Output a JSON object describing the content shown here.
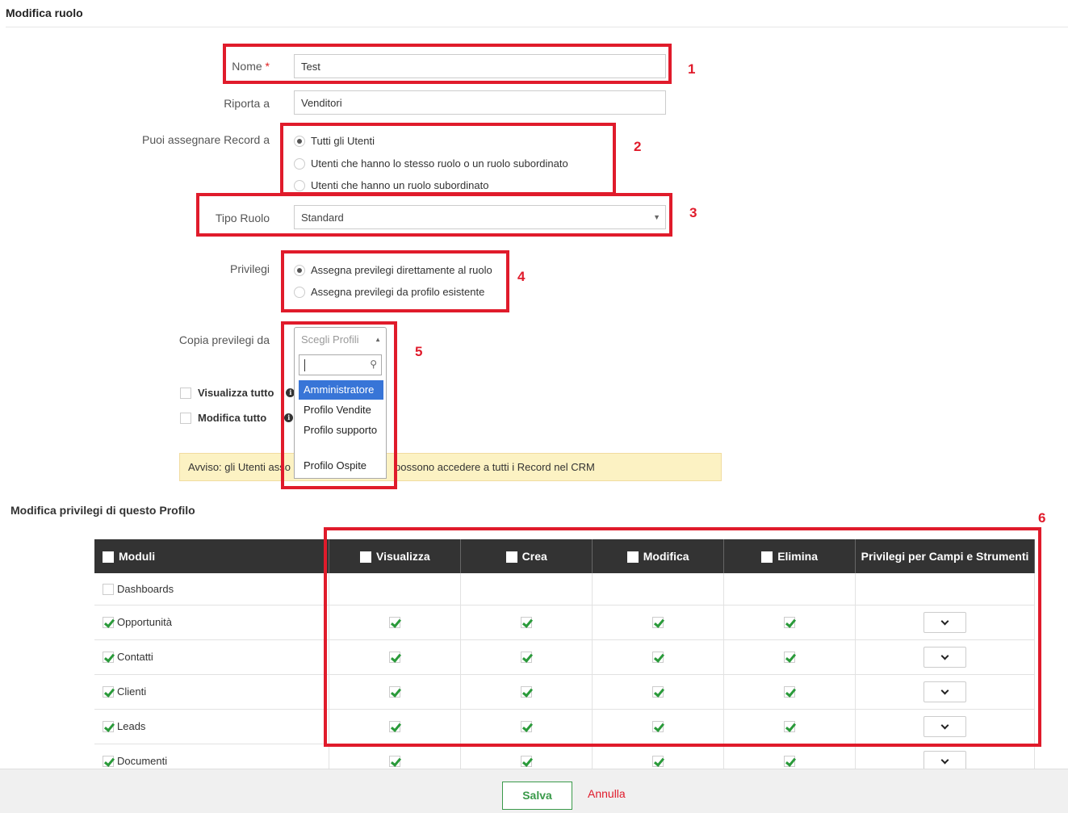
{
  "page": {
    "title": "Modifica ruolo"
  },
  "form": {
    "name": {
      "label": "Nome",
      "required_mark": "*",
      "value": "Test"
    },
    "reports_to": {
      "label": "Riporta a",
      "value": "Venditori"
    },
    "assign_records": {
      "label": "Puoi assegnare Record a",
      "options": [
        {
          "label": "Tutti gli Utenti",
          "selected": true
        },
        {
          "label": "Utenti che hanno lo stesso ruolo o un ruolo subordinato",
          "selected": false
        },
        {
          "label": "Utenti che hanno un ruolo subordinato",
          "selected": false
        }
      ]
    },
    "role_type": {
      "label": "Tipo Ruolo",
      "value": "Standard"
    },
    "privileges": {
      "label": "Privilegi",
      "options": [
        {
          "label": "Assegna previlegi direttamente al ruolo",
          "selected": true
        },
        {
          "label": "Assegna previlegi da profilo esistente",
          "selected": false
        }
      ]
    },
    "copy_from": {
      "label": "Copia previlegi da",
      "placeholder": "Scegli Profili",
      "options": [
        {
          "label": "Amministratore",
          "highlighted": true
        },
        {
          "label": "Profilo Vendite",
          "highlighted": false
        },
        {
          "label": "Profilo supporto",
          "highlighted": false
        },
        {
          "label": "Profilo Ospite",
          "highlighted": false
        }
      ]
    },
    "view_all": {
      "label": "Visualizza tutto"
    },
    "edit_all": {
      "label": "Modifica tutto"
    },
    "warning": "Avviso: gli Utenti asso",
    "warning_tail": "possono accedere a tutti i Record nel CRM"
  },
  "profile_section": {
    "title": "Modifica privilegi di questo Profilo",
    "columns": [
      "Moduli",
      "Visualizza",
      "Crea",
      "Modifica",
      "Elimina",
      "Privilegi per Campi e Strumenti"
    ],
    "rows": [
      {
        "module": "Dashboards",
        "checked": false,
        "view": false,
        "create": false,
        "edit": false,
        "delete": false,
        "has_tools": false
      },
      {
        "module": "Opportunità",
        "checked": true,
        "view": true,
        "create": true,
        "edit": true,
        "delete": true,
        "has_tools": true
      },
      {
        "module": "Contatti",
        "checked": true,
        "view": true,
        "create": true,
        "edit": true,
        "delete": true,
        "has_tools": true
      },
      {
        "module": "Clienti",
        "checked": true,
        "view": true,
        "create": true,
        "edit": true,
        "delete": true,
        "has_tools": true
      },
      {
        "module": "Leads",
        "checked": true,
        "view": true,
        "create": true,
        "edit": true,
        "delete": true,
        "has_tools": true
      },
      {
        "module": "Documenti",
        "checked": true,
        "view": true,
        "create": true,
        "edit": true,
        "delete": true,
        "has_tools": true
      }
    ]
  },
  "callouts": [
    "1",
    "2",
    "3",
    "4",
    "5",
    "6"
  ],
  "footer": {
    "save_label": "Salva",
    "cancel_label": "Annulla"
  },
  "colors": {
    "annotation_red": "#e01b2b",
    "accent_blue": "#3875d7",
    "success_green": "#2a9a3a",
    "warning_bg": "#fcf2c3"
  }
}
